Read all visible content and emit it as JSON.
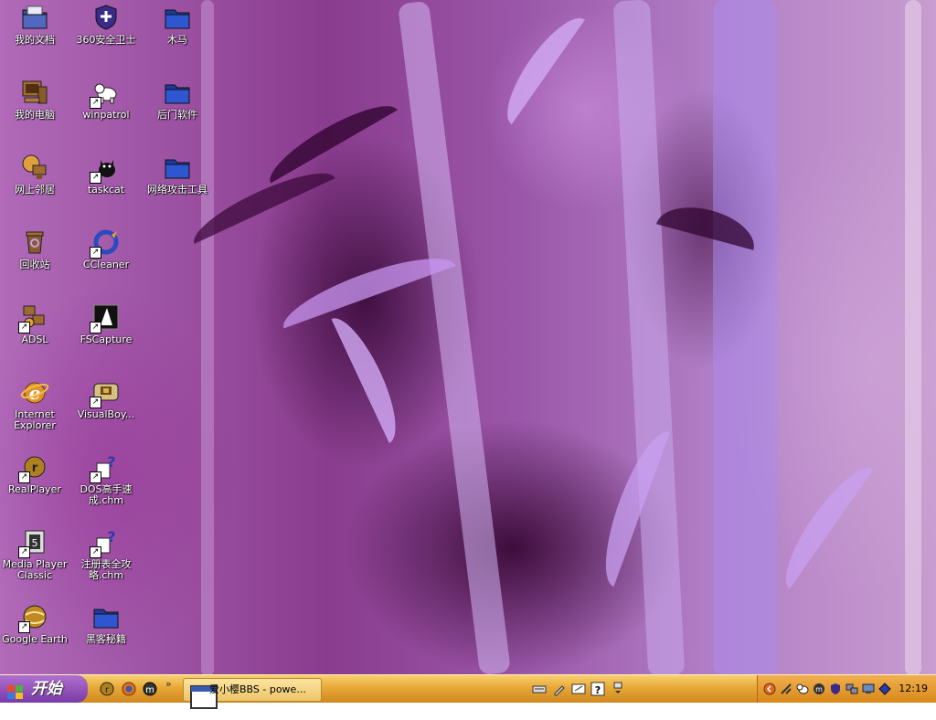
{
  "desktop": {
    "icons": [
      {
        "label": "我的文档"
      },
      {
        "label": "360安全卫士"
      },
      {
        "label": "木马"
      },
      {
        "label": "我的电脑"
      },
      {
        "label": "winpatrol"
      },
      {
        "label": "后门软件"
      },
      {
        "label": "网上邻居"
      },
      {
        "label": "taskcat"
      },
      {
        "label": "网络攻击工具"
      },
      {
        "label": "回收站"
      },
      {
        "label": "CCleaner"
      },
      {
        "label": "ADSL"
      },
      {
        "label": "FSCapture"
      },
      {
        "label": "Internet Explorer"
      },
      {
        "label": "VisualBoy..."
      },
      {
        "label": "RealPlayer"
      },
      {
        "label": "DOS高手速成.chm"
      },
      {
        "label": "Media Player Classic"
      },
      {
        "label": "注册表全攻略.chm"
      },
      {
        "label": "Google Earth"
      },
      {
        "label": "黑客秘籍"
      }
    ]
  },
  "taskbar": {
    "start_label": "开始",
    "quick_launch_chevron": "»",
    "task_item_label": "爱小樱BBS - powe...",
    "clock": "12:19"
  },
  "colors": {
    "taskbar": "#e8a838",
    "start_button": "#8a4ab8",
    "tray": "#e09a30"
  }
}
